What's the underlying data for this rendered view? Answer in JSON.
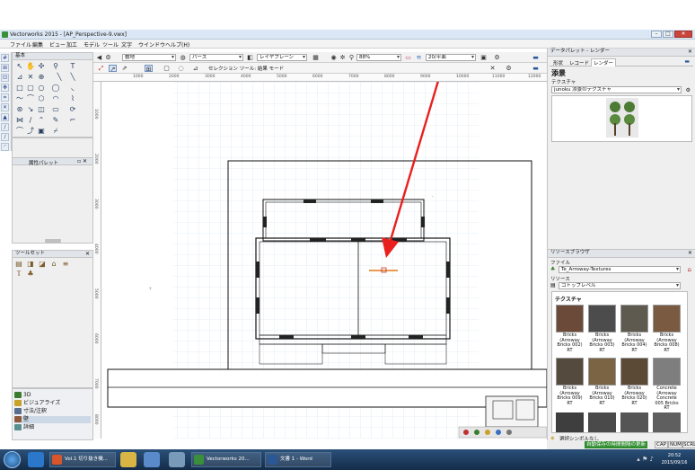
{
  "window": {
    "title": "Vectorworks 2015 - [AP_Perspective-9.vwx]",
    "controls": [
      "–",
      "□",
      "✕"
    ]
  },
  "menu": [
    "ファイル",
    "編集",
    "ビュー",
    "加工",
    "モデル",
    "ツール",
    "文字",
    "ウインドウ",
    "ヘルプ(H)"
  ],
  "basic_palette": {
    "title": "基本"
  },
  "attribute_palette": {
    "title": "属性パレット"
  },
  "toolset_palette": {
    "title": "ツールセット"
  },
  "workspace_items": [
    {
      "label": "3D",
      "color": "#3a7d2c"
    },
    {
      "label": "ビジュアライズ",
      "color": "#c9a227"
    },
    {
      "label": "寸法/注釈",
      "color": "#5a6f8f"
    },
    {
      "label": "壁",
      "color": "#8f5a3a"
    },
    {
      "label": "詳細",
      "color": "#5a8f8f"
    }
  ],
  "view_bar": {
    "class": "敷地",
    "view": "パース",
    "layer": "レイヤプレーン",
    "zoom": "88%",
    "scale": "20/平面",
    "tool_label": "セレクション ツール: 結果 モード"
  },
  "rulers": {
    "h": [
      "1000",
      "2000",
      "3000",
      "4000",
      "5000",
      "6000",
      "7000",
      "8000",
      "9000",
      "10000",
      "11000",
      "12000"
    ],
    "v": [
      "1000",
      "2000",
      "3000",
      "4000",
      "5000",
      "6000",
      "7000",
      "8000"
    ]
  },
  "data_palette": {
    "title": "データパレット - レンダー",
    "tabs": [
      "形状",
      "レコード",
      "レンダー"
    ],
    "section": "添景",
    "texture_label": "テクスチャ",
    "texture_value": "junoku 添景のテクスチャ"
  },
  "resource_browser": {
    "title": "リソースブラウザ",
    "file_label": "ファイル",
    "file_value": "Te_Arroway-Textures",
    "resource_label": "リソース",
    "resource_value": "ゴトップレベル",
    "category": "テクスチャ",
    "items": [
      {
        "name": "Bricks (Arroway Bricks 002) RT",
        "color": "#6b4a3a"
      },
      {
        "name": "Bricks (Arroway Bricks 003) RT",
        "color": "#4c4c4c"
      },
      {
        "name": "Bricks (Arroway Bricks 004) RT",
        "color": "#5e5a50"
      },
      {
        "name": "Bricks (Arroway Bricks 008) RT",
        "color": "#7a5a40"
      },
      {
        "name": "Bricks (Arroway Bricks 009) RT",
        "color": "#544a3e"
      },
      {
        "name": "Bricks (Arroway Bricks 010) RT",
        "color": "#7a6444"
      },
      {
        "name": "Bricks (Arroway Bricks 020) RT",
        "color": "#5a4a36"
      },
      {
        "name": "Concrete (Arroway Concrete 005 Bricks RT",
        "color": "#7e7e7e"
      }
    ],
    "footer": "選択シンボルなし"
  },
  "status": {
    "green_label": "自動保存の時間間隔の更新",
    "cap": "CAP",
    "num": "NUM",
    "scrl": "SCRL"
  },
  "taskbar": {
    "items": [
      {
        "label": "Vol.1 切り抜き機...",
        "color": "#d9552b"
      },
      {
        "label": "Vectorworks 20...",
        "color": "#3a8f3a"
      },
      {
        "label": "文書 1 - Word",
        "color": "#2b5797"
      }
    ],
    "time": "20:52",
    "date": "2015/09/16"
  },
  "annotation": {
    "arrow_color": "#e8201e",
    "marker_color": "#e07a1a"
  }
}
